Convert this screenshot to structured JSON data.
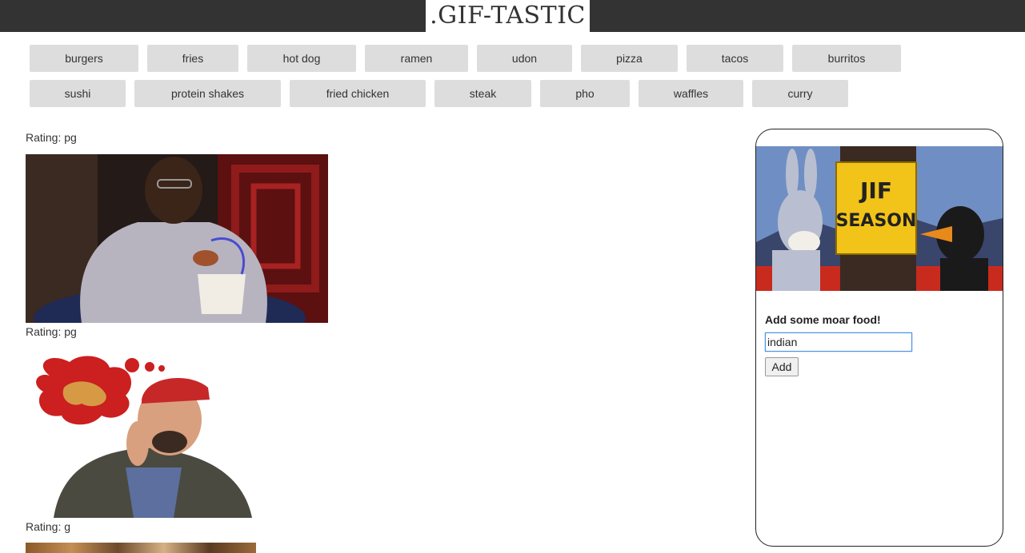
{
  "header": {
    "title": ".GIF-TASTIC"
  },
  "topics": [
    "burgers",
    "fries",
    "hot dog",
    "ramen",
    "udon",
    "pizza",
    "tacos",
    "burritos",
    "sushi",
    "protein shakes",
    "fried chicken",
    "steak",
    "pho",
    "waffles",
    "curry"
  ],
  "results": [
    {
      "rating": "Rating: pg"
    },
    {
      "rating": "Rating: pg"
    },
    {
      "rating": "Rating: g"
    }
  ],
  "side_panel": {
    "sign_line1": "JIF",
    "sign_line2": "SEASON",
    "add_label": "Add some moar food!",
    "input_value": "indian",
    "add_button": "Add"
  }
}
